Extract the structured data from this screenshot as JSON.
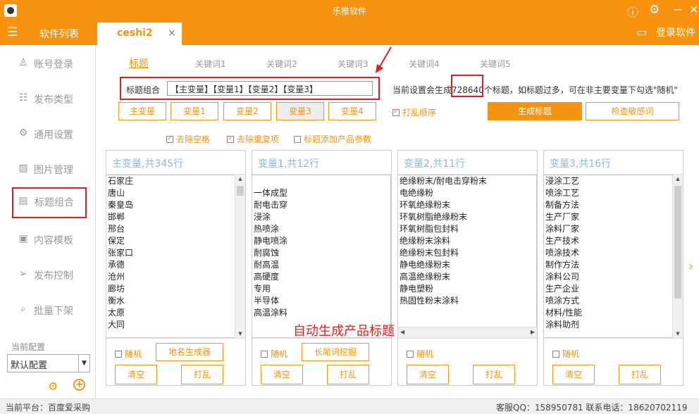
{
  "app": {
    "title": "乐推软件"
  },
  "topbar": {
    "menu_label": "软件列表",
    "tab_label": "ceshi2",
    "tab_close": "×",
    "login_label": "登录软件"
  },
  "sidebar": {
    "items": [
      {
        "label": "账号登录",
        "icon": "person-icon"
      },
      {
        "label": "发布类型",
        "icon": "list-icon"
      },
      {
        "label": "通用设置",
        "icon": "gear-icon"
      },
      {
        "label": "图片管理",
        "icon": "image-icon"
      },
      {
        "label": "标题组合",
        "icon": "document-icon"
      },
      {
        "label": "内容模板",
        "icon": "template-icon"
      },
      {
        "label": "发布控制",
        "icon": "send-icon"
      },
      {
        "label": "批量下架",
        "icon": "search-icon"
      }
    ],
    "config_label": "当前配置",
    "config_value": "默认配置"
  },
  "keyword_tabs": [
    "标题",
    "关键词1",
    "关键词2",
    "关键词3",
    "关键词4",
    "关键词5"
  ],
  "combo": {
    "label": "标题组合",
    "value": "【主变量】【变量1】【变量2】【变量3】"
  },
  "info": {
    "prefix": "当前设置会生成",
    "count": "728640",
    "suffix": "个标题，如标题过多，可在非主要变量下勾选\"随机\""
  },
  "var_buttons": [
    "主变量",
    "变量1",
    "变量2",
    "变量3",
    "变量4"
  ],
  "shuffle_order": "打乱顺序",
  "generate_button": "生成标题",
  "check_button": "检查敏感词",
  "options": [
    "去除空格",
    "去除重复项",
    "标题添加产品参数"
  ],
  "panels": [
    {
      "title": "主变量,共345行",
      "items": [
        "石家庄",
        "唐山",
        "秦皇岛",
        "邯郸",
        "邢台",
        "保定",
        "张家口",
        "承德",
        "沧州",
        "廊坊",
        "衡水",
        "太原",
        "大同"
      ],
      "tool": "地名生成器"
    },
    {
      "title": "变量1,共12行",
      "items": [
        "",
        "一体成型",
        "耐电击穿",
        "浸涂",
        "热喷涂",
        "静电喷涂",
        "耐腐蚀",
        "耐高温",
        "高硬度",
        "专用",
        "半导体",
        "高温涂料"
      ],
      "tool": "长尾词挖掘"
    },
    {
      "title": "变量2,共11行",
      "items": [
        "绝缘粉末/耐电击穿粉末",
        "电绝缘粉",
        "环氧绝缘粉末",
        "环氧树脂绝缘粉末",
        "环氧树脂包封料",
        "绝缘粉末涂料",
        "绝缘粉末包封料",
        "静电绝缘粉末",
        "高温绝缘粉末",
        "静电塑粉",
        "热固性粉末涂料"
      ],
      "tool": ""
    },
    {
      "title": "变量3,共16行",
      "items": [
        "浸涂工艺",
        "喷涂工艺",
        "制备方法",
        "生产厂家",
        "涂料厂家",
        "生产技术",
        "喷涂技术",
        "制作方法",
        "涂料公司",
        "生产企业",
        "喷涂方式",
        "材料/性能",
        "涂料助剂"
      ],
      "tool": ""
    }
  ],
  "panel_footer": {
    "random": "随机",
    "clear": "清空",
    "shuffle": "打乱"
  },
  "overlay_text": "自动生成产品标题",
  "status": {
    "platform": "当前平台：百度爱采购",
    "contact": "客服QQ：158950781   联系电话：18620702119"
  },
  "colors": {
    "accent": "#f7930e",
    "annotation": "#e61c1c"
  }
}
